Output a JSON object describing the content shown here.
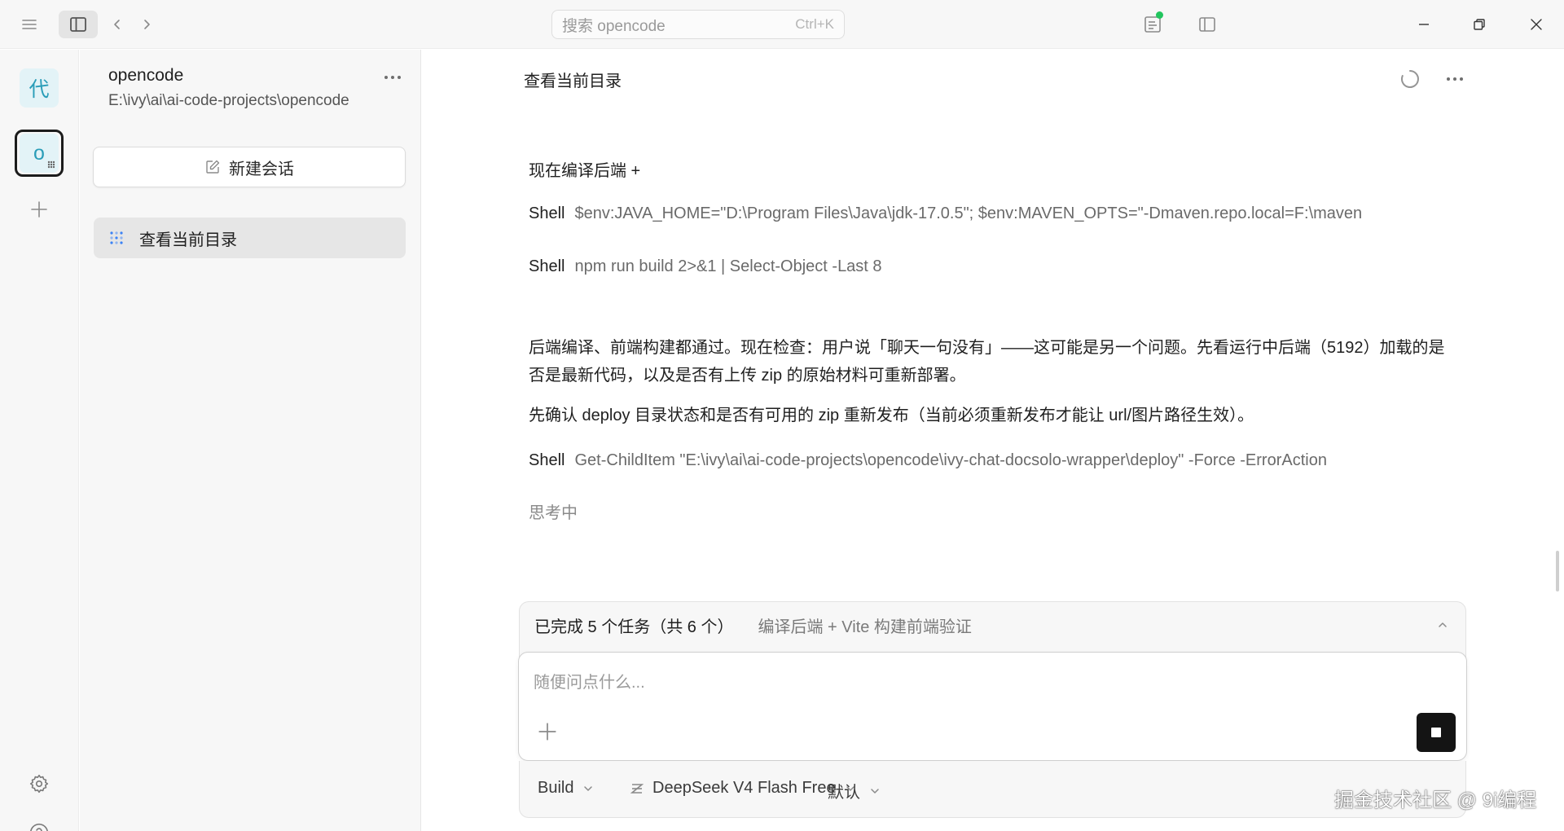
{
  "titlebar": {
    "search_placeholder": "搜索 opencode",
    "search_shortcut": "Ctrl+K"
  },
  "rail": {
    "projects": [
      {
        "label": "代"
      },
      {
        "label": "o"
      }
    ]
  },
  "sidebar": {
    "project_name": "opencode",
    "project_path": "E:\\ivy\\ai\\ai-code-projects\\opencode",
    "new_session_label": "新建会话",
    "sessions": [
      {
        "title": "查看当前目录"
      }
    ]
  },
  "main": {
    "title": "查看当前目录",
    "messages": {
      "m1": "现在编译后端 +",
      "shell1": {
        "tag": "Shell",
        "cmd": "$env:JAVA_HOME=\"D:\\Program Files\\Java\\jdk-17.0.5\"; $env:MAVEN_OPTS=\"-Dmaven.repo.local=F:\\maven"
      },
      "shell2": {
        "tag": "Shell",
        "cmd": "npm run build 2>&1 | Select-Object -Last 8"
      },
      "p1": "后端编译、前端构建都通过。现在检查：用户说「聊天一句没有」——这可能是另一个问题。先看运行中后端（5192）加载的是否是最新代码，以及是否有上传 zip 的原始材料可重新部署。",
      "p2": "先确认 deploy 目录状态和是否有可用的 zip 重新发布（当前必须重新发布才能让 url/图片路径生效）。",
      "shell3": {
        "tag": "Shell",
        "cmd": "Get-ChildItem \"E:\\ivy\\ai\\ai-code-projects\\opencode\\ivy-chat-docsolo-wrapper\\deploy\" -Force -ErrorAction"
      },
      "thinking": "思考中"
    },
    "tasks": {
      "count": "已完成 5 个任务（共 6 个）",
      "current": "编译后端 + Vite 构建前端验证"
    },
    "composer": {
      "placeholder": "随便问点什么..."
    },
    "toolbar": {
      "agent": "Build",
      "model": "DeepSeek V4 Flash Free",
      "variant": "默认"
    }
  },
  "watermark": "掘金技术社区 @ 9i编程"
}
